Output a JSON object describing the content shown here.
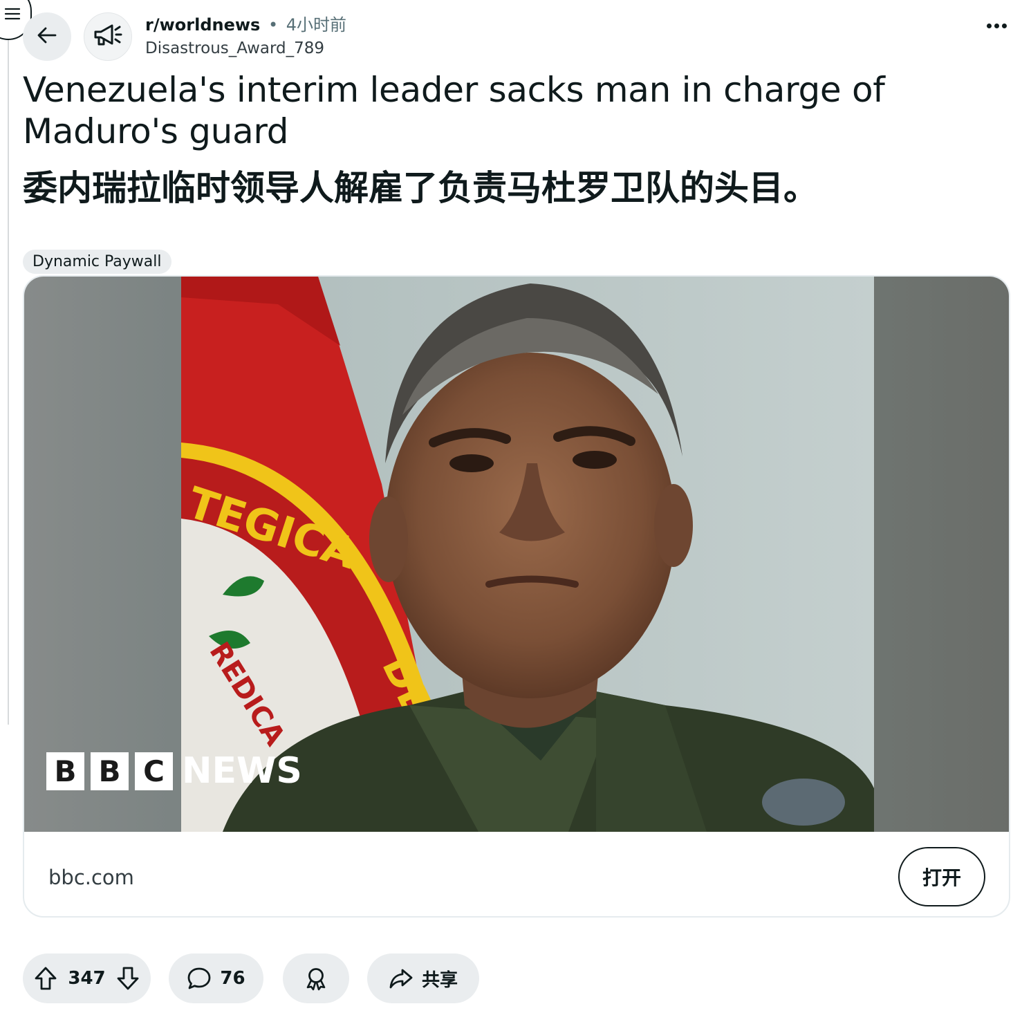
{
  "post": {
    "subreddit": "r/worldnews",
    "separator": "•",
    "time": "4小时前",
    "author": "Disastrous_Award_789",
    "title_en": "Venezuela's interim leader sacks man in charge of Maduro's guard",
    "title_cn": "委内瑞拉临时领导人解雇了负责马杜罗卫队的头目。",
    "flair": "Dynamic Paywall"
  },
  "link_card": {
    "domain": "bbc.com",
    "open_label": "打开",
    "image_alt": "Portrait of a uniformed man in front of a red flag with a partial emblem",
    "logo": {
      "letters": [
        "B",
        "B",
        "C"
      ],
      "word": "NEWS"
    },
    "flag_text": [
      "TEGICA",
      "REDICA",
      "DE"
    ]
  },
  "actions": {
    "upvotes": "347",
    "comments": "76",
    "share_label": "共享"
  },
  "icons": {
    "menu": "menu-icon",
    "back": "arrow-left-icon",
    "avatar": "megaphone-icon",
    "more": "more-horizontal-icon",
    "upvote": "upvote-icon",
    "downvote": "downvote-icon",
    "comment": "comment-icon",
    "award": "award-icon",
    "share": "share-icon"
  },
  "colors": {
    "text": "#0f1a1c",
    "muted": "#576f76",
    "pill_bg": "#eaedef",
    "flag_red": "#c8201f"
  }
}
